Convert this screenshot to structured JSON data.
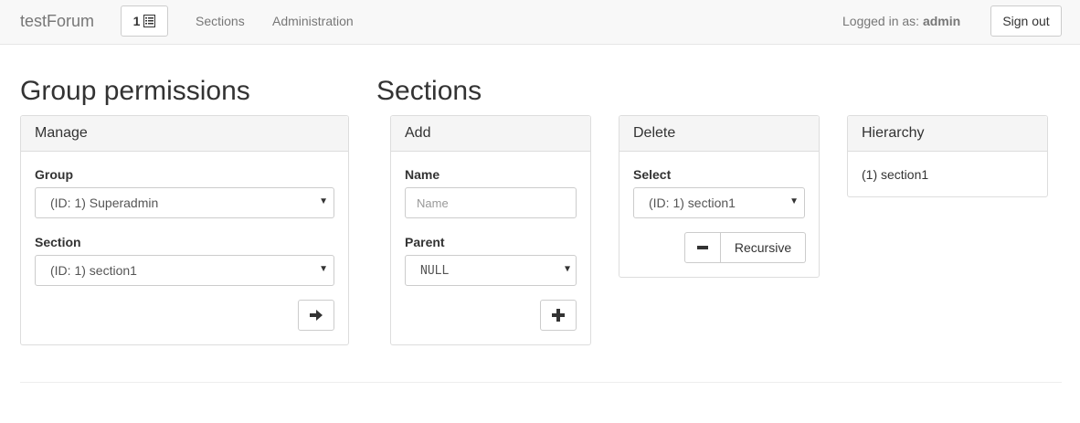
{
  "navbar": {
    "brand": "testForum",
    "notifications_count": "1",
    "links": [
      "Sections",
      "Administration"
    ],
    "logged_prefix": "Logged in as:",
    "username": "admin",
    "signout_label": "Sign out"
  },
  "group_permissions": {
    "title": "Group permissions",
    "panel_title": "Manage",
    "group_label": "Group",
    "group_value": "(ID: 1) Superadmin",
    "section_label": "Section",
    "section_value": "(ID: 1) section1"
  },
  "sections": {
    "title": "Sections",
    "add": {
      "panel_title": "Add",
      "name_label": "Name",
      "name_placeholder": "Name",
      "parent_label": "Parent",
      "parent_value": "NULL"
    },
    "delete": {
      "panel_title": "Delete",
      "select_label": "Select",
      "select_value": "(ID: 1) section1",
      "recursive_label": "Recursive"
    },
    "hierarchy": {
      "panel_title": "Hierarchy",
      "items": [
        "(1) section1"
      ]
    }
  }
}
